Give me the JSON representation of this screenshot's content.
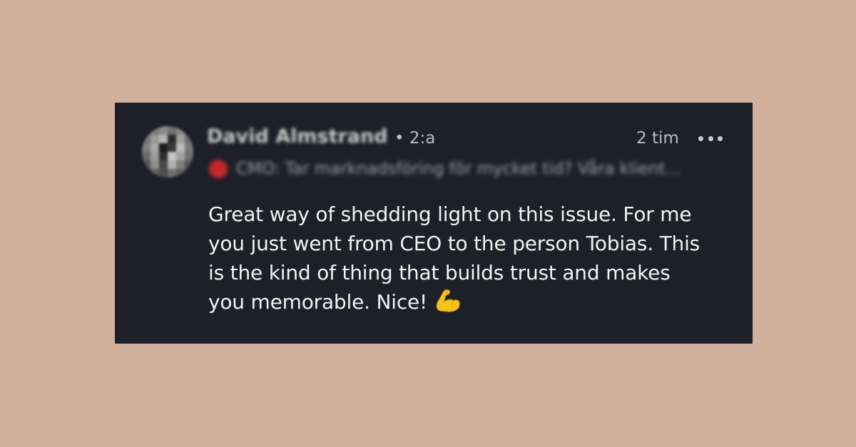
{
  "comment": {
    "author_name": "David Almstrand",
    "connection_degree": "• 2:a",
    "timestamp": "2 tim",
    "author_headline": "CMO: Tar marknadsföring för mycket tid? Våra klient...",
    "body": "Great way of shedding light on this issue. For me you just went from CEO to the person Tobias. This is the kind of thing that builds trust and makes you memorable. Nice!",
    "emoji": "flexed-biceps-icon"
  },
  "colors": {
    "page_background": "#d2b19c",
    "card_background": "#1d2028",
    "text_primary": "#f2f2f2",
    "text_secondary": "#b9bcc2",
    "emoji_fill": "#f5c518"
  }
}
